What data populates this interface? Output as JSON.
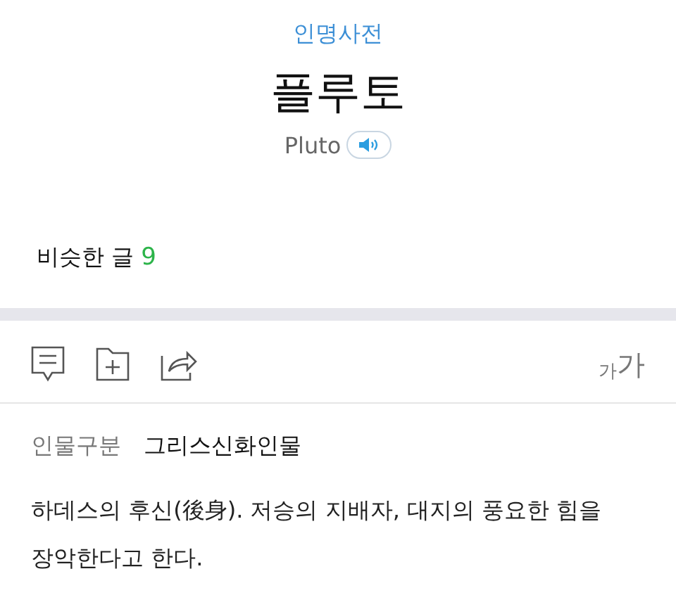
{
  "header": {
    "category": "인명사전",
    "title": "플루토",
    "original_name": "Pluto"
  },
  "similar": {
    "label": "비슷한 글",
    "count": "9"
  },
  "toolbar": {
    "font_size_small": "가",
    "font_size_large": "가"
  },
  "info": [
    {
      "label": "인물구분",
      "value": "그리스신화인물"
    }
  ],
  "description": "하데스의 후신(後身). 저승의 지배자, 대지의 풍요한 힘을 장악한다고 한다."
}
